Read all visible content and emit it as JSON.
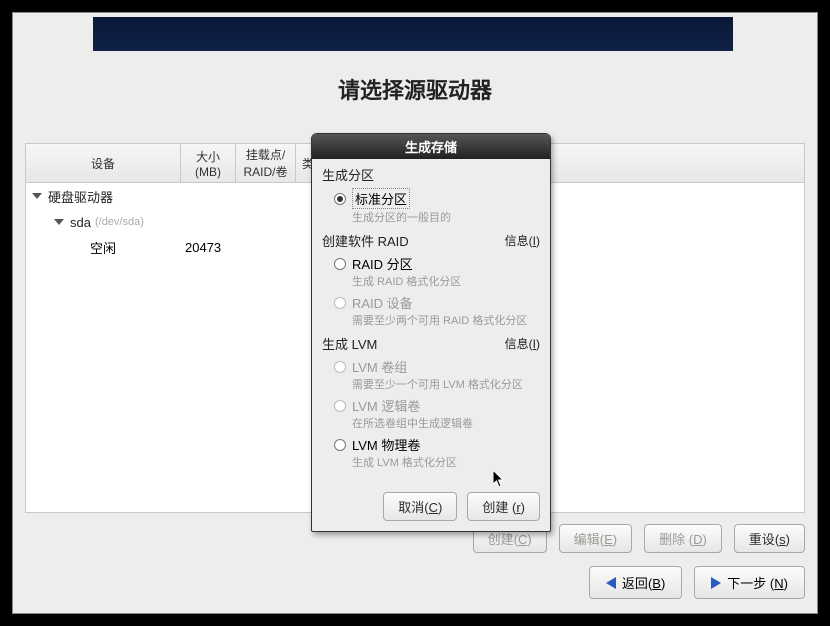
{
  "page_title": "请选择源驱动器",
  "table": {
    "headers": {
      "device": "设备",
      "size_label": "大小",
      "size_unit": "(MB)",
      "mount_label": "挂载点/",
      "mount_sub": "RAID/卷",
      "type": "类型"
    },
    "root": "硬盘驱动器",
    "device": "sda",
    "device_path": "(/dev/sda)",
    "free_label": "空闲",
    "free_size": "20473"
  },
  "buttons": {
    "create_main": "创建",
    "create_main_accel": "C",
    "edit": "编辑",
    "edit_accel": "E",
    "delete": "删除",
    "delete_accel": "D",
    "reset": "重设",
    "reset_accel": "s",
    "back": "返回",
    "back_accel": "B",
    "next": "下一步",
    "next_accel": "N"
  },
  "dialog": {
    "title": "生成存储",
    "section_partition": "生成分区",
    "opt_standard": "标准分区",
    "opt_standard_desc": "生成分区的一般目的",
    "section_raid": "创建软件 RAID",
    "info": "信息",
    "info_accel": "I",
    "opt_raid_part": "RAID 分区",
    "opt_raid_part_desc": "生成 RAID 格式化分区",
    "opt_raid_dev": "RAID 设备",
    "opt_raid_dev_desc": "需要至少两个可用 RAID 格式化分区",
    "section_lvm": "生成 LVM",
    "opt_lvm_vg": "LVM 卷组",
    "opt_lvm_vg_desc": "需要至少一个可用 LVM 格式化分区",
    "opt_lvm_lv": "LVM 逻辑卷",
    "opt_lvm_lv_desc": "在所选卷组中生成逻辑卷",
    "opt_lvm_pv": "LVM 物理卷",
    "opt_lvm_pv_desc": "生成 LVM 格式化分区",
    "cancel": "取消",
    "cancel_accel": "C",
    "create": "创建",
    "create_accel": "r"
  }
}
